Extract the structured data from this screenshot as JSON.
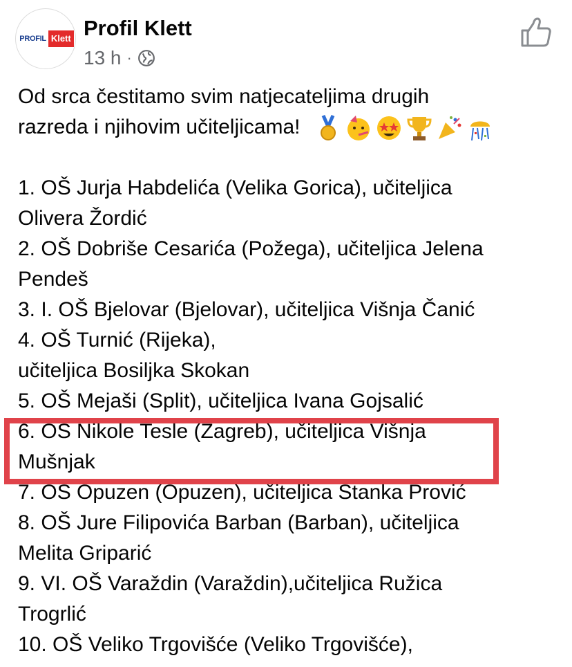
{
  "post": {
    "author": "Profil Klett",
    "logo_left": "PROFIL",
    "logo_right": "Klett",
    "time": "13 h",
    "separator": "·",
    "intro_line1": "Od srca čestitamo svim natjecateljima drugih",
    "intro_line2": "razreda i njihovim učiteljicama!",
    "emojis": [
      "sports-medal-icon",
      "partying-face-icon",
      "star-struck-icon",
      "trophy-icon",
      "party-popper-icon",
      "confetti-ball-icon"
    ],
    "list_lines": [
      "1. OŠ Jurja Habdelića (Velika Gorica), učiteljica",
      "Olivera Žordić",
      "2. OŠ Dobriše Cesarića (Požega), učiteljica Jelena",
      "Pendeš",
      "3. I. OŠ Bjelovar (Bjelovar), učiteljica Višnja Čanić",
      "4. OŠ Turnić (Rijeka),",
      "učiteljica Bosiljka Skokan",
      "5. OŠ Mejaši (Split), učiteljica Ivana Gojsalić",
      "6. OŠ Nikole Tesle (Zagreb), učiteljica Višnja",
      "Mušnjak",
      "7. OŠ Opuzen (Opuzen), učiteljica Stanka Prović",
      "8. OŠ Jure Filipovića Barban (Barban), učiteljica",
      "Melita Griparić",
      "9. VI. OŠ Varaždin (Varaždin),učiteljica Ružica",
      "Trogrlić",
      "10. OŠ Veliko Trgovišće (Veliko Trgovišće),"
    ]
  },
  "colors": {
    "highlight": "#e0434a",
    "meta_text": "#65676b",
    "logo_red": "#e32b2b",
    "logo_blue": "#1b3f8f"
  }
}
